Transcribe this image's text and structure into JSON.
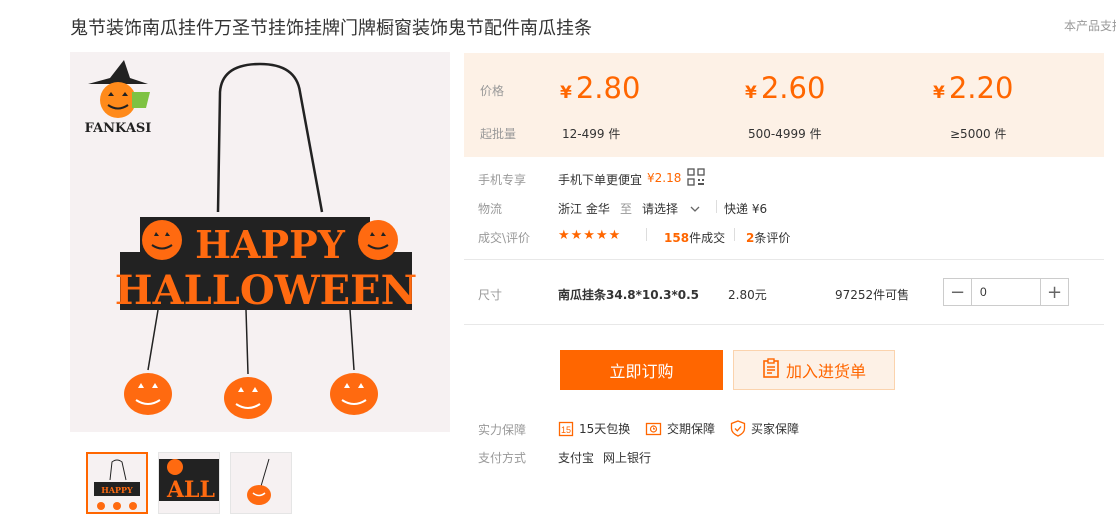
{
  "product": {
    "title": "鬼节装饰南瓜挂件万圣节挂饰挂牌门牌橱窗装饰鬼节配件南瓜挂条",
    "top_right_text": "本产品支持"
  },
  "image": {
    "brand": "FANKASI",
    "sign_line1": "HAPPY",
    "sign_line2": "HALLOWEEN",
    "thumb2_text": "ALL"
  },
  "price_panel": {
    "price_label": "价格",
    "min_order_label": "起批量",
    "currency": "¥",
    "tiers": [
      {
        "price": "2.80",
        "range": "12-499 件"
      },
      {
        "price": "2.60",
        "range": "500-4999 件"
      },
      {
        "price": "2.20",
        "range": "≥5000 件"
      }
    ]
  },
  "mobile": {
    "label": "手机专享",
    "text": "手机下单更便宜",
    "price": "¥2.18"
  },
  "logistics": {
    "label": "物流",
    "origin": "浙江 金华",
    "to": "至",
    "select": "请选择",
    "express": "快递 ¥6"
  },
  "reviews": {
    "label": "成交\\评价",
    "stars": "★★★★★",
    "deal_count": "158",
    "deal_suffix": "件成交",
    "review_count": "2",
    "review_suffix": "条评价"
  },
  "size": {
    "label": "尺寸",
    "name": "南瓜挂条34.8*10.3*0.5",
    "price": "2.80元",
    "stock": "97252件可售",
    "qty": "0",
    "minus": "−",
    "plus": "+"
  },
  "actions": {
    "buy": "立即订购",
    "cart": "加入进货单"
  },
  "guarantee": {
    "label": "实力保障",
    "items": [
      "15天包换",
      "交期保障",
      "买家保障"
    ]
  },
  "payment": {
    "label": "支付方式",
    "methods": [
      "支付宝",
      "网上银行"
    ]
  },
  "colors": {
    "accent": "#ff6600",
    "panel_bg": "#fdf1e6"
  }
}
